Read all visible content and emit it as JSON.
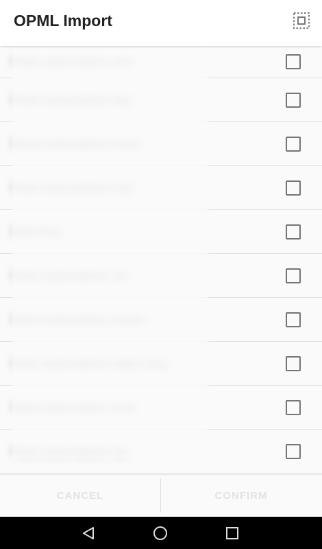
{
  "appbar": {
    "title": "OPML Import",
    "select_all_icon": "select-all-icon"
  },
  "feeds": [
    {
      "label": "Feed subscription one",
      "checked": false
    },
    {
      "label": "Feed subscription two",
      "checked": false
    },
    {
      "label": "Feed subscription three",
      "checked": false
    },
    {
      "label": "Feed subscription four",
      "checked": false
    },
    {
      "label": "Feed five",
      "checked": false
    },
    {
      "label": "Feed subscription six",
      "checked": false
    },
    {
      "label": "Feed subscription seven",
      "checked": false
    },
    {
      "label": "Feed subscription eight long",
      "checked": false
    },
    {
      "label": "Feed subscription nine",
      "checked": false
    },
    {
      "label": "Feed subscription ten",
      "checked": false
    }
  ],
  "buttons": {
    "cancel_label": "CANCEL",
    "confirm_label": "CONFIRM"
  },
  "navbar": {
    "back_icon": "back-triangle-icon",
    "home_icon": "home-circle-icon",
    "recents_icon": "recents-square-icon"
  },
  "colors": {
    "checkbox_border": "#757575",
    "divider": "#e0e0e0",
    "button_text_disabled": "#e3e3e3",
    "navbar_bg": "#000000"
  }
}
